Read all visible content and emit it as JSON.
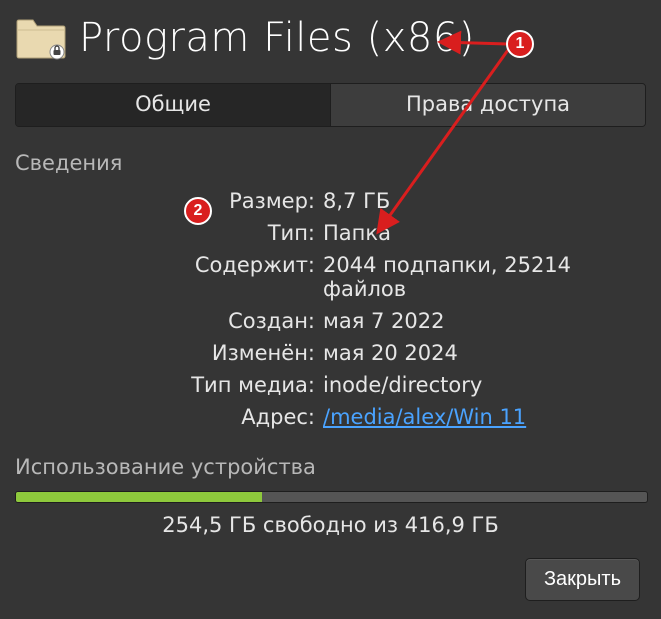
{
  "header": {
    "title": "Program Files (x86)",
    "icon": "folder-locked-icon"
  },
  "tabs": {
    "general": "Общие",
    "permissions": "Права доступа",
    "active": "general"
  },
  "sections": {
    "details_title": "Сведения",
    "usage_title": "Использование устройства"
  },
  "details": {
    "size_label": "Размер:",
    "size_value": "8,7 ГБ",
    "type_label": "Тип:",
    "type_value": "Папка",
    "contains_label": "Содержит:",
    "contains_value": "2044 подпапки, 25214 файлов",
    "created_label": "Создан:",
    "created_value": "мая  7 2022",
    "modified_label": "Изменён:",
    "modified_value": "мая 20 2024",
    "media_type_label": "Тип медиа:",
    "media_type_value": "inode/directory",
    "address_label": "Адрес:",
    "address_value": "/media/alex/Win 11"
  },
  "usage": {
    "text": "254,5 ГБ свободно из 416,9 ГБ",
    "used_percent": 39
  },
  "footer": {
    "close_label": "Закрыть"
  },
  "annotations": {
    "badge1": "1",
    "badge2": "2"
  },
  "colors": {
    "badge_bg": "#d91e1e",
    "progress_fill": "#8ec93c",
    "link": "#4aa3ff"
  }
}
